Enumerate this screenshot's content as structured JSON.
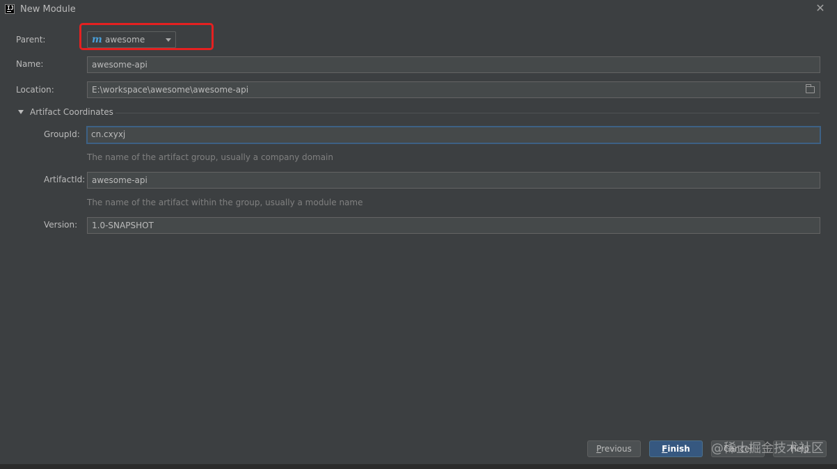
{
  "window": {
    "title": "New Module",
    "app_icon": "intellij-idea-icon",
    "close_icon": "close-icon"
  },
  "parent": {
    "label": "Parent:",
    "value": "awesome",
    "icon": "maven-module-icon"
  },
  "name": {
    "label": "Name:",
    "value": "awesome-api"
  },
  "location": {
    "label": "Location:",
    "value": "E:\\workspace\\awesome\\awesome-api",
    "browse_icon": "folder-icon"
  },
  "artifact_section": {
    "title": "Artifact Coordinates",
    "expanded": true,
    "group_id": {
      "label": "GroupId:",
      "value": "cn.cxyxj",
      "hint": "The name of the artifact group, usually a company domain"
    },
    "artifact_id": {
      "label": "ArtifactId:",
      "value": "awesome-api",
      "hint": "The name of the artifact within the group, usually a module name"
    },
    "version": {
      "label": "Version:",
      "value": "1.0-SNAPSHOT"
    }
  },
  "buttons": {
    "previous": {
      "mnemonic": "P",
      "rest": "revious"
    },
    "finish": {
      "mnemonic": "F",
      "rest": "inish"
    },
    "cancel": "Cancel",
    "help": "Help"
  },
  "watermark": "@稀土掘金技术社区",
  "colors": {
    "highlight": "#e52020",
    "focus_border": "#3d6185",
    "finish_button": "#365880",
    "maven_icon": "#4a9fd8"
  }
}
